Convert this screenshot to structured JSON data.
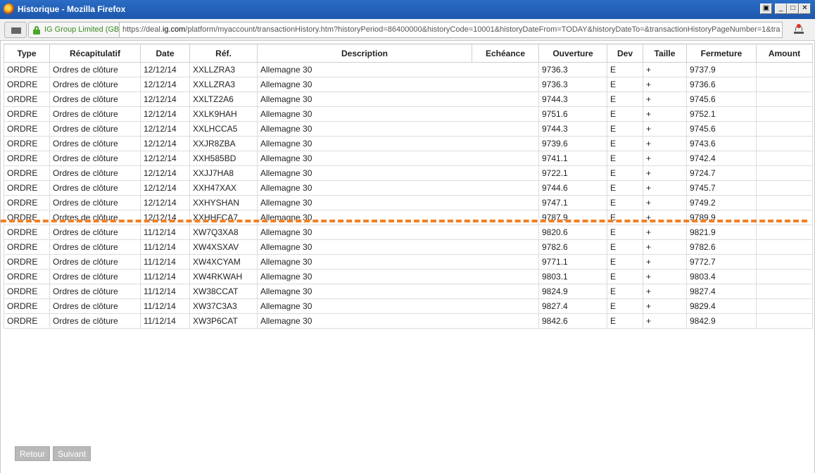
{
  "window": {
    "title": "Historique - Mozilla Firefox"
  },
  "addressbar": {
    "identity": "IG Group Limited (GB)",
    "url_prefix": "https://deal.",
    "url_domain": "ig.com",
    "url_rest": "/platform/myaccount/transactionHistory.htm?historyPeriod=86400000&historyCode=10001&historyDateFrom=TODAY&historyDateTo=&transactionHistoryPageNumber=1&tra"
  },
  "table": {
    "headers": [
      "Type",
      "Récapitulatif",
      "Date",
      "Réf.",
      "Description",
      "Echéance",
      "Ouverture",
      "Dev",
      "Taille",
      "Fermeture",
      "Amount"
    ],
    "rows": [
      [
        "ORDRE",
        "Ordres de clôture",
        "12/12/14",
        "XXLLZRA3",
        "Allemagne 30",
        "",
        "9736.3",
        "E",
        "+",
        "9737.9",
        ""
      ],
      [
        "ORDRE",
        "Ordres de clôture",
        "12/12/14",
        "XXLLZRA3",
        "Allemagne 30",
        "",
        "9736.3",
        "E",
        "+",
        "9736.6",
        ""
      ],
      [
        "ORDRE",
        "Ordres de clôture",
        "12/12/14",
        "XXLTZ2A6",
        "Allemagne 30",
        "",
        "9744.3",
        "E",
        "+",
        "9745.6",
        ""
      ],
      [
        "ORDRE",
        "Ordres de clôture",
        "12/12/14",
        "XXLK9HAH",
        "Allemagne 30",
        "",
        "9751.6",
        "E",
        "+",
        "9752.1",
        ""
      ],
      [
        "ORDRE",
        "Ordres de clôture",
        "12/12/14",
        "XXLHCCA5",
        "Allemagne 30",
        "",
        "9744.3",
        "E",
        "+",
        "9745.6",
        ""
      ],
      [
        "ORDRE",
        "Ordres de clôture",
        "12/12/14",
        "XXJR8ZBA",
        "Allemagne 30",
        "",
        "9739.6",
        "E",
        "+",
        "9743.6",
        ""
      ],
      [
        "ORDRE",
        "Ordres de clôture",
        "12/12/14",
        "XXH585BD",
        "Allemagne 30",
        "",
        "9741.1",
        "E",
        "+",
        "9742.4",
        ""
      ],
      [
        "ORDRE",
        "Ordres de clôture",
        "12/12/14",
        "XXJJ7HA8",
        "Allemagne 30",
        "",
        "9722.1",
        "E",
        "+",
        "9724.7",
        ""
      ],
      [
        "ORDRE",
        "Ordres de clôture",
        "12/12/14",
        "XXH47XAX",
        "Allemagne 30",
        "",
        "9744.6",
        "E",
        "+",
        "9745.7",
        ""
      ],
      [
        "ORDRE",
        "Ordres de clôture",
        "12/12/14",
        "XXHYSHAN",
        "Allemagne 30",
        "",
        "9747.1",
        "E",
        "+",
        "9749.2",
        ""
      ],
      [
        "ORDRE",
        "Ordres de clôture",
        "12/12/14",
        "XXHHFCA7",
        "Allemagne 30",
        "",
        "9787.9",
        "E",
        "+",
        "9789.9",
        ""
      ],
      [
        "ORDRE",
        "Ordres de clôture",
        "11/12/14",
        "XW7Q3XA8",
        "Allemagne 30",
        "",
        "9820.6",
        "E",
        "+",
        "9821.9",
        ""
      ],
      [
        "ORDRE",
        "Ordres de clôture",
        "11/12/14",
        "XW4XSXAV",
        "Allemagne 30",
        "",
        "9782.6",
        "E",
        "+",
        "9782.6",
        ""
      ],
      [
        "ORDRE",
        "Ordres de clôture",
        "11/12/14",
        "XW4XCYAM",
        "Allemagne 30",
        "",
        "9771.1",
        "E",
        "+",
        "9772.7",
        ""
      ],
      [
        "ORDRE",
        "Ordres de clôture",
        "11/12/14",
        "XW4RKWAH",
        "Allemagne 30",
        "",
        "9803.1",
        "E",
        "+",
        "9803.4",
        ""
      ],
      [
        "ORDRE",
        "Ordres de clôture",
        "11/12/14",
        "XW38CCAT",
        "Allemagne 30",
        "",
        "9824.9",
        "E",
        "+",
        "9827.4",
        ""
      ],
      [
        "ORDRE",
        "Ordres de clôture",
        "11/12/14",
        "XW37C3A3",
        "Allemagne 30",
        "",
        "9827.4",
        "E",
        "+",
        "9829.4",
        ""
      ],
      [
        "ORDRE",
        "Ordres de clôture",
        "11/12/14",
        "XW3P6CAT",
        "Allemagne 30",
        "",
        "9842.6",
        "E",
        "+",
        "9842.9",
        ""
      ]
    ]
  },
  "pager": {
    "back_label": "Retour",
    "next_label": "Suivant"
  },
  "colors": {
    "titlebar": "#1d57ad",
    "separator": "#f08023",
    "pager_button": "#b9b9b9"
  },
  "icons": [
    "firefox-icon",
    "tab-groups-icon",
    "lock-icon",
    "notification-icon"
  ]
}
